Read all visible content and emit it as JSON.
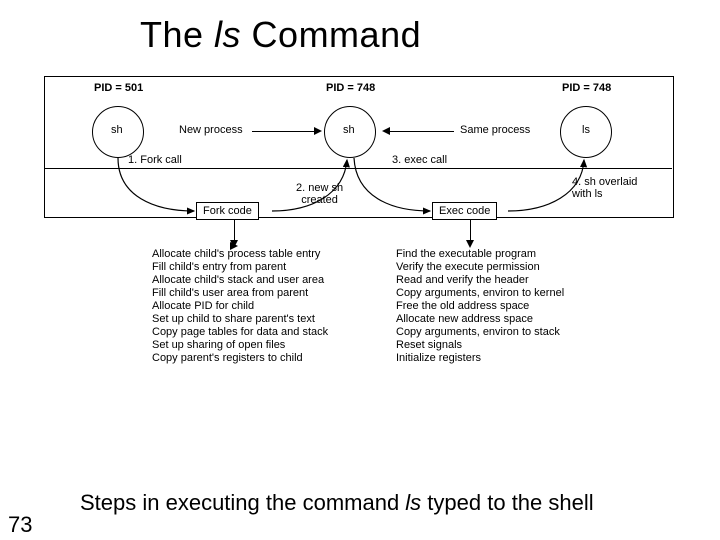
{
  "title_pre": "The ",
  "title_em": "ls",
  "title_post": " Command",
  "pid1": "PID = 501",
  "pid2": "PID = 748",
  "pid3": "PID = 748",
  "c1": "sh",
  "c2": "sh",
  "c3": "ls",
  "a_new": "New process",
  "a_same": "Same process",
  "n1": "1. Fork call",
  "n2": "2. new sh\ncreated",
  "n3": "3. exec call",
  "n4": "4. sh overlaid\nwith ls",
  "box_fork": "Fork code",
  "box_exec": "Exec code",
  "fork_steps": "Allocate child's process table entry\nFill child's entry from parent\nAllocate child's stack and user area\nFill child's user area from parent\nAllocate PID for child\nSet up child to share parent's text\nCopy page tables for data and stack\nSet up sharing of open files\nCopy parent's registers to child",
  "exec_steps": "Find the executable program\nVerify the execute permission\nRead and verify the header\nCopy arguments, environ to kernel\nFree the old address space\nAllocate new address space\nCopy arguments, environ to stack\nReset signals\nInitialize registers",
  "caption_pre": "Steps in executing the command ",
  "caption_em": "ls",
  "caption_post": " typed to the shell",
  "pagenum": "73"
}
